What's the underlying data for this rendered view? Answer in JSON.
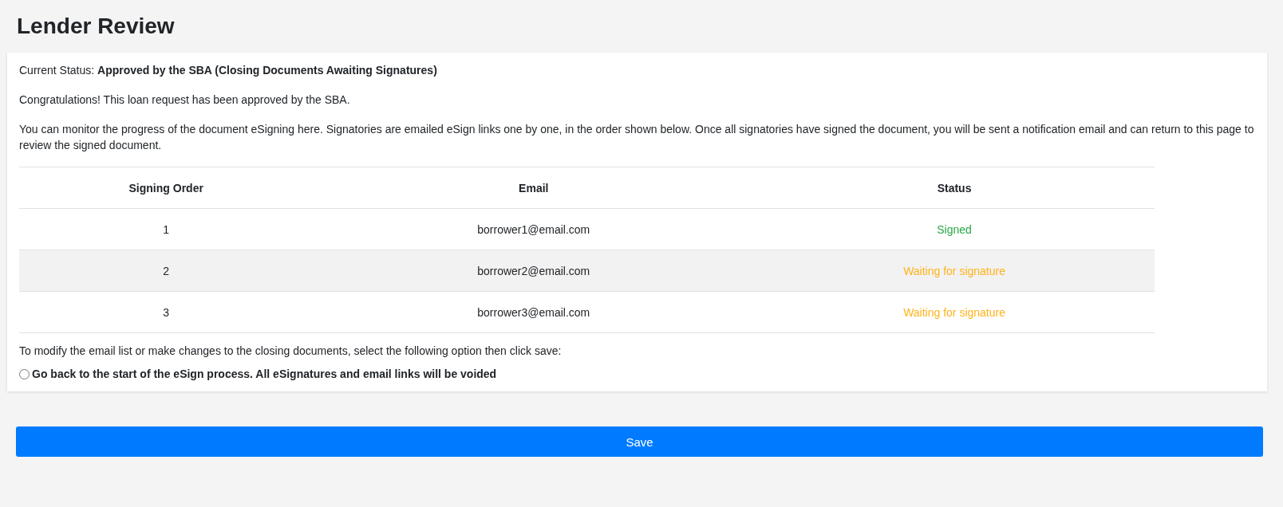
{
  "page_title": "Lender Review",
  "status_line": "Current Status: **Approved by the SBA (Closing Documents Awaiting Signatures)**",
  "message": "Congratulations! This loan request has been approved by the SBA.",
  "description": "You can monitor the progress of the document eSigning here. Signatories are emailed eSign links one by one, in the order shown below. Once all signatories have signed the document, you will be sent a notification email and can return to this page to review the signed document.",
  "table": {
    "columns": [
      "Signing Order",
      "Email",
      "Status"
    ],
    "rows": [
      {
        "order": "1",
        "email": "borrower1@email.com",
        "status": "Signed",
        "color": "#28a745"
      },
      {
        "order": "2",
        "email": "borrower2@email.com",
        "status": "Waiting for signature",
        "color": "#ffb31a"
      },
      {
        "order": "3",
        "email": "borrower3@email.com",
        "status": "Waiting for signature",
        "color": "#ffb31a"
      }
    ]
  },
  "modify_hint": "To modify the email list or make changes to the closing documents, select the following option then click save:",
  "option": {
    "label": "Go back to the start of the eSign process. All eSignatures and email links will be voided",
    "checked": false
  },
  "save_button": "Save"
}
